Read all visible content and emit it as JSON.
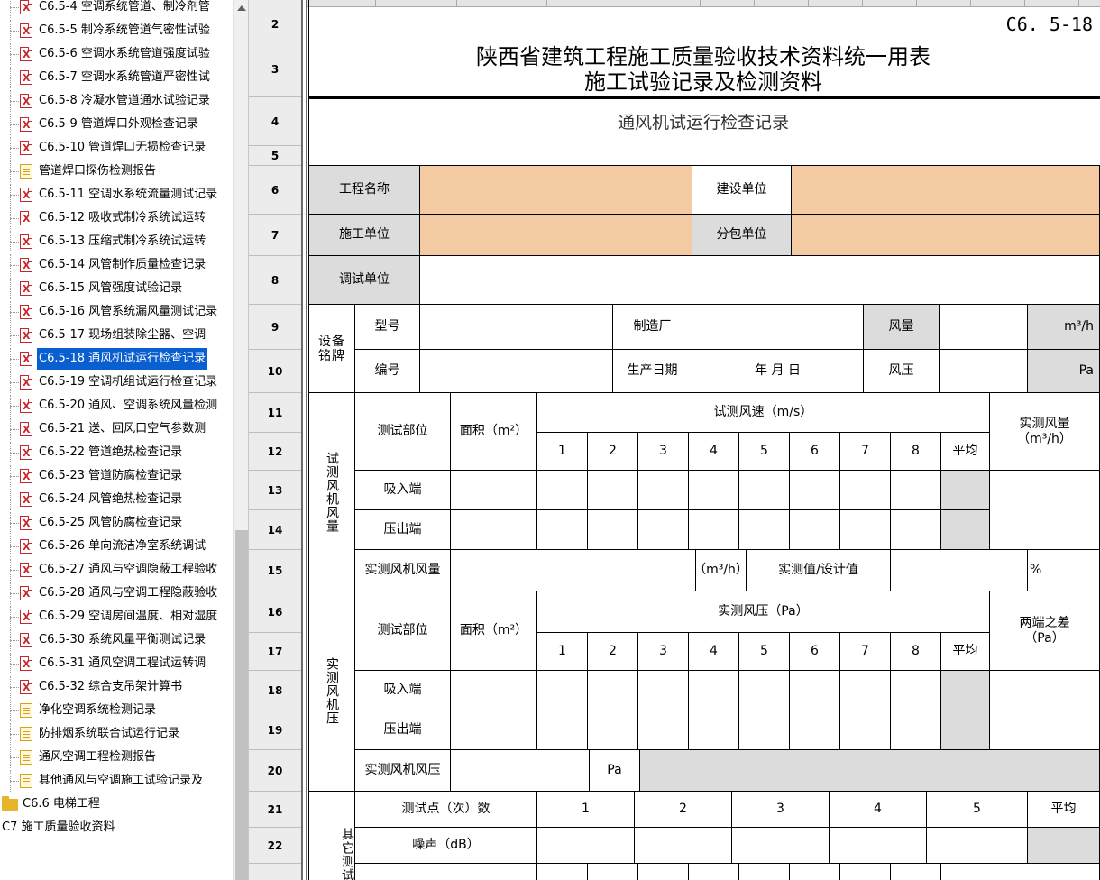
{
  "tree": {
    "items": [
      {
        "type": "x",
        "label": "C6.5-4 空调系统管道、制冷剂管"
      },
      {
        "type": "x",
        "label": "C6.5-5 制冷系统管道气密性试验"
      },
      {
        "type": "x",
        "label": "C6.5-6 空调水系统管道强度试验"
      },
      {
        "type": "x",
        "label": "C6.5-7 空调水系统管道严密性试"
      },
      {
        "type": "x",
        "label": "C6.5-8 冷凝水管道通水试验记录"
      },
      {
        "type": "x",
        "label": "C6.5-9 管道焊口外观检查记录"
      },
      {
        "type": "x",
        "label": "C6.5-10 管道焊口无损检查记录"
      },
      {
        "type": "doc",
        "label": "管道焊口探伤检测报告"
      },
      {
        "type": "x",
        "label": "C6.5-11 空调水系统流量测试记录"
      },
      {
        "type": "x",
        "label": "C6.5-12 吸收式制冷系统试运转"
      },
      {
        "type": "x",
        "label": "C6.5-13 压缩式制冷系统试运转"
      },
      {
        "type": "x",
        "label": "C6.5-14 风管制作质量检查记录"
      },
      {
        "type": "x",
        "label": "C6.5-15 风管强度试验记录"
      },
      {
        "type": "x",
        "label": "C6.5-16 风管系统漏风量测试记录"
      },
      {
        "type": "x",
        "label": "C6.5-17 现场组装除尘器、空调"
      },
      {
        "type": "x",
        "label": "C6.5-18 通风机试运行检查记录",
        "selected": true
      },
      {
        "type": "x",
        "label": "C6.5-19 空调机组试运行检查记录"
      },
      {
        "type": "x",
        "label": "C6.5-20 通风、空调系统风量检测"
      },
      {
        "type": "x",
        "label": "C6.5-21 送、回风口空气参数测"
      },
      {
        "type": "x",
        "label": "C6.5-22 管道绝热检查记录"
      },
      {
        "type": "x",
        "label": "C6.5-23 管道防腐检查记录"
      },
      {
        "type": "x",
        "label": "C6.5-24 风管绝热检查记录"
      },
      {
        "type": "x",
        "label": "C6.5-25 风管防腐检查记录"
      },
      {
        "type": "x",
        "label": "C6.5-26 单向流洁净室系统调试"
      },
      {
        "type": "x",
        "label": "C6.5-27 通风与空调隐蔽工程验收"
      },
      {
        "type": "x",
        "label": "C6.5-28 通风与空调工程隐蔽验收"
      },
      {
        "type": "x",
        "label": "C6.5-29 空调房间温度、相对湿度"
      },
      {
        "type": "x",
        "label": "C6.5-30 系统风量平衡测试记录"
      },
      {
        "type": "x",
        "label": "C6.5-31 通风空调工程试运转调"
      },
      {
        "type": "x",
        "label": "C6.5-32 综合支吊架计算书"
      },
      {
        "type": "doc",
        "label": "净化空调系统检测记录"
      },
      {
        "type": "doc",
        "label": "防排烟系统联合试运行记录"
      },
      {
        "type": "doc",
        "label": "通风空调工程检测报告"
      },
      {
        "type": "doc",
        "label": "其他通风与空调施工试验记录及"
      },
      {
        "type": "folder",
        "label": "C6.6 电梯工程"
      },
      {
        "type": "plain",
        "label": "C7 施工质量验收资料"
      }
    ]
  },
  "sheet": {
    "row_numbers": [
      "2",
      "3",
      "4",
      "5",
      "6",
      "7",
      "8",
      "9",
      "10",
      "11",
      "12",
      "13",
      "14",
      "15",
      "16",
      "17",
      "18",
      "19",
      "20",
      "21",
      "22"
    ],
    "form_code": "C6. 5-18",
    "title_main": "陕西省建筑工程施工质量验收技术资料统一用表",
    "title_sub": "施工试验记录及检测资料",
    "record_title": "通风机试运行检查记录",
    "labels": {
      "project_name": "工程名称",
      "builder": "建设单位",
      "construction_unit": "施工单位",
      "subcontractor": "分包单位",
      "debug_unit": "调试单位",
      "nameplate": "设备铭牌",
      "model": "型号",
      "manufacturer": "制造厂",
      "air_volume": "风量",
      "air_volume_unit": "m³/h",
      "serial": "编号",
      "production_date": "生产日期",
      "date_placeholder": "年  月  日",
      "air_pressure": "风压",
      "pressure_unit": "Pa",
      "test_volume_section": "试测风机风量",
      "test_location": "测试部位",
      "area": "面积（m²）",
      "test_speed": "试测风速（m/s）",
      "measured_volume": "实测风量",
      "measured_volume_unit": "（m³/h）",
      "suction_end": "吸入端",
      "discharge_end": "压出端",
      "measured_fan_volume": "实测风机风量",
      "volume_unit_paren": "（m³/h）",
      "actual_design": "实测值/设计值",
      "percent": "%",
      "measured_pressure_section": "实测风机压",
      "measured_pressure": "实测风压（Pa）",
      "pressure_diff": "两端之差",
      "pressure_diff_unit": "（Pa）",
      "measured_fan_pressure": "实测风机风压",
      "other_tests": "其它测试",
      "test_points": "测试点（次）数",
      "noise": "噪声（dB）",
      "average": "平均"
    },
    "speed_columns": [
      "1",
      "2",
      "3",
      "4",
      "5",
      "6",
      "7",
      "8"
    ],
    "test_point_columns": [
      "1",
      "2",
      "3",
      "4",
      "5"
    ]
  },
  "colors": {
    "selection": "#0a5fd0",
    "input_fill": "#f3caa2",
    "gray_fill": "#dcdcdc",
    "error_icon": "#c9232b"
  }
}
